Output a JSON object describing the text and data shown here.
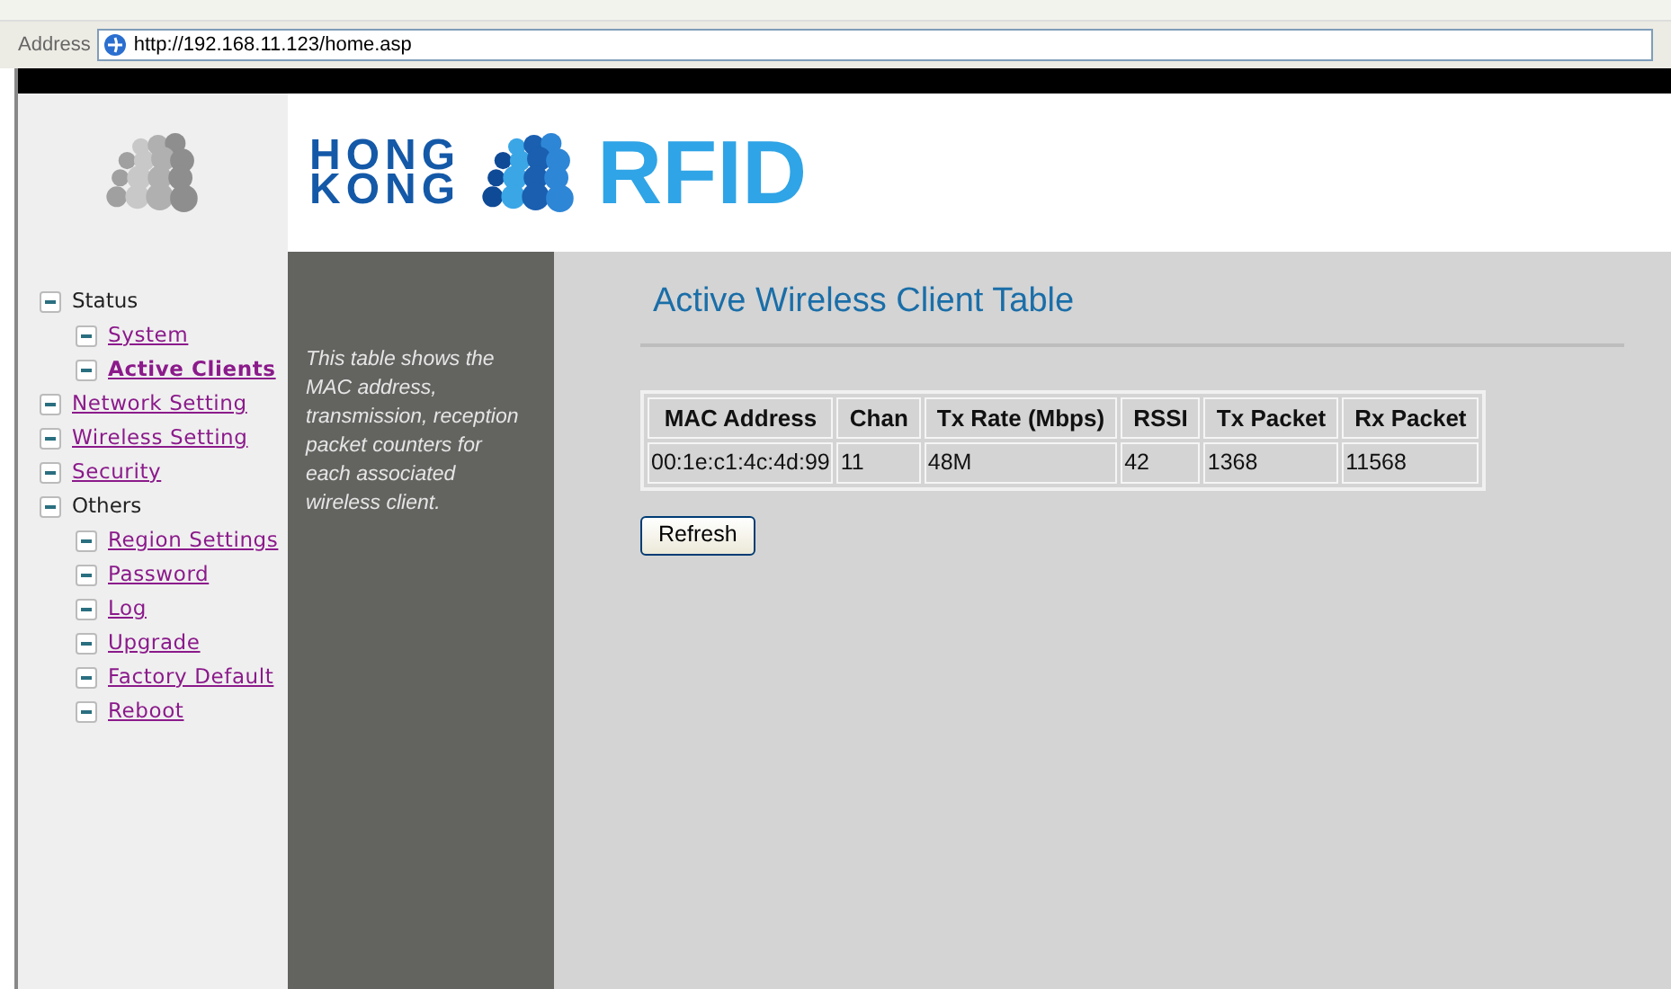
{
  "address_bar": {
    "label": "Address",
    "url": "http://192.168.11.123/home.asp"
  },
  "logo": {
    "line_1": "HONG",
    "line_2": "KONG",
    "word": "RFID"
  },
  "nav": [
    {
      "label": "Status",
      "kind": "group",
      "selected": false,
      "children": [
        {
          "label": "System",
          "kind": "link",
          "selected": false
        },
        {
          "label": "Active Clients",
          "kind": "link",
          "selected": true
        }
      ]
    },
    {
      "label": "Network Setting",
      "kind": "link",
      "selected": false
    },
    {
      "label": "Wireless Setting",
      "kind": "link",
      "selected": false
    },
    {
      "label": "Security",
      "kind": "link",
      "selected": false
    },
    {
      "label": "Others",
      "kind": "group",
      "selected": false,
      "children": [
        {
          "label": "Region Settings",
          "kind": "link",
          "selected": false
        },
        {
          "label": "Password",
          "kind": "link",
          "selected": false
        },
        {
          "label": "Log",
          "kind": "link",
          "selected": false
        },
        {
          "label": "Upgrade",
          "kind": "link",
          "selected": false
        },
        {
          "label": "Factory Default",
          "kind": "link",
          "selected": false
        },
        {
          "label": "Reboot",
          "kind": "link",
          "selected": false
        }
      ]
    }
  ],
  "description": "This table shows the MAC address, transmission, reception packet counters for each associated wireless client.",
  "page_title": "Active Wireless Client Table",
  "table": {
    "columns": [
      "MAC Address",
      "Chan",
      "Tx Rate (Mbps)",
      "RSSI",
      "Tx Packet",
      "Rx Packet"
    ],
    "rows": [
      [
        "00:1e:c1:4c:4d:99",
        "11",
        "48M",
        "42",
        "1368",
        "11568"
      ]
    ]
  },
  "refresh_button": "Refresh"
}
